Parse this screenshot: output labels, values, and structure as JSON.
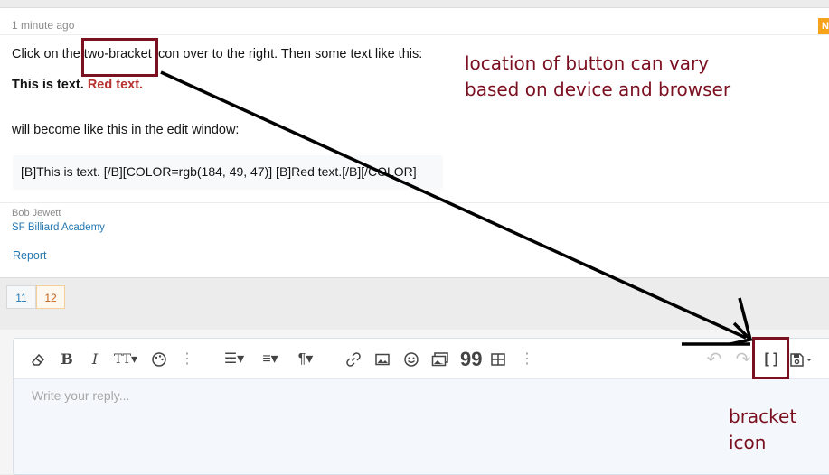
{
  "post": {
    "timestamp": "1 minute ago",
    "badge": "N",
    "line1": "Click on the two-bracket icon over to the right. Then some text like this:",
    "line2_bold": "This is text.",
    "line2_red": "Red text.",
    "line3": "will become like this in the edit window:",
    "code": "[B]This is text. [/B][COLOR=rgb(184, 49, 47)] [B]Red text.[/B][/COLOR]",
    "author": "Bob Jewett",
    "signature": "SF Billiard Academy",
    "report_label": "Report",
    "red_text_color": "#b8312f"
  },
  "pagination": {
    "pages": [
      "11",
      "12"
    ],
    "current": "12"
  },
  "editor": {
    "placeholder": "Write your reply...",
    "toolbar": [
      "eraser-icon",
      "bold-icon",
      "italic-icon",
      "text-size-icon",
      "palette-icon",
      "more-icon",
      "list-icon",
      "align-icon",
      "paragraph-icon",
      "link-icon",
      "image-icon",
      "smilie-icon",
      "media-icon",
      "quote-icon",
      "table-icon",
      "more-icon",
      "undo-icon",
      "redo-icon",
      "bbcode-toggle-icon",
      "drafts-icon"
    ],
    "accent": "#2577b1"
  },
  "annotations": {
    "color": "#7b1020",
    "note1_line1": "location of button can vary",
    "note1_line2": "based on device and browser",
    "note2_line1": "bracket",
    "note2_line2": "icon"
  }
}
